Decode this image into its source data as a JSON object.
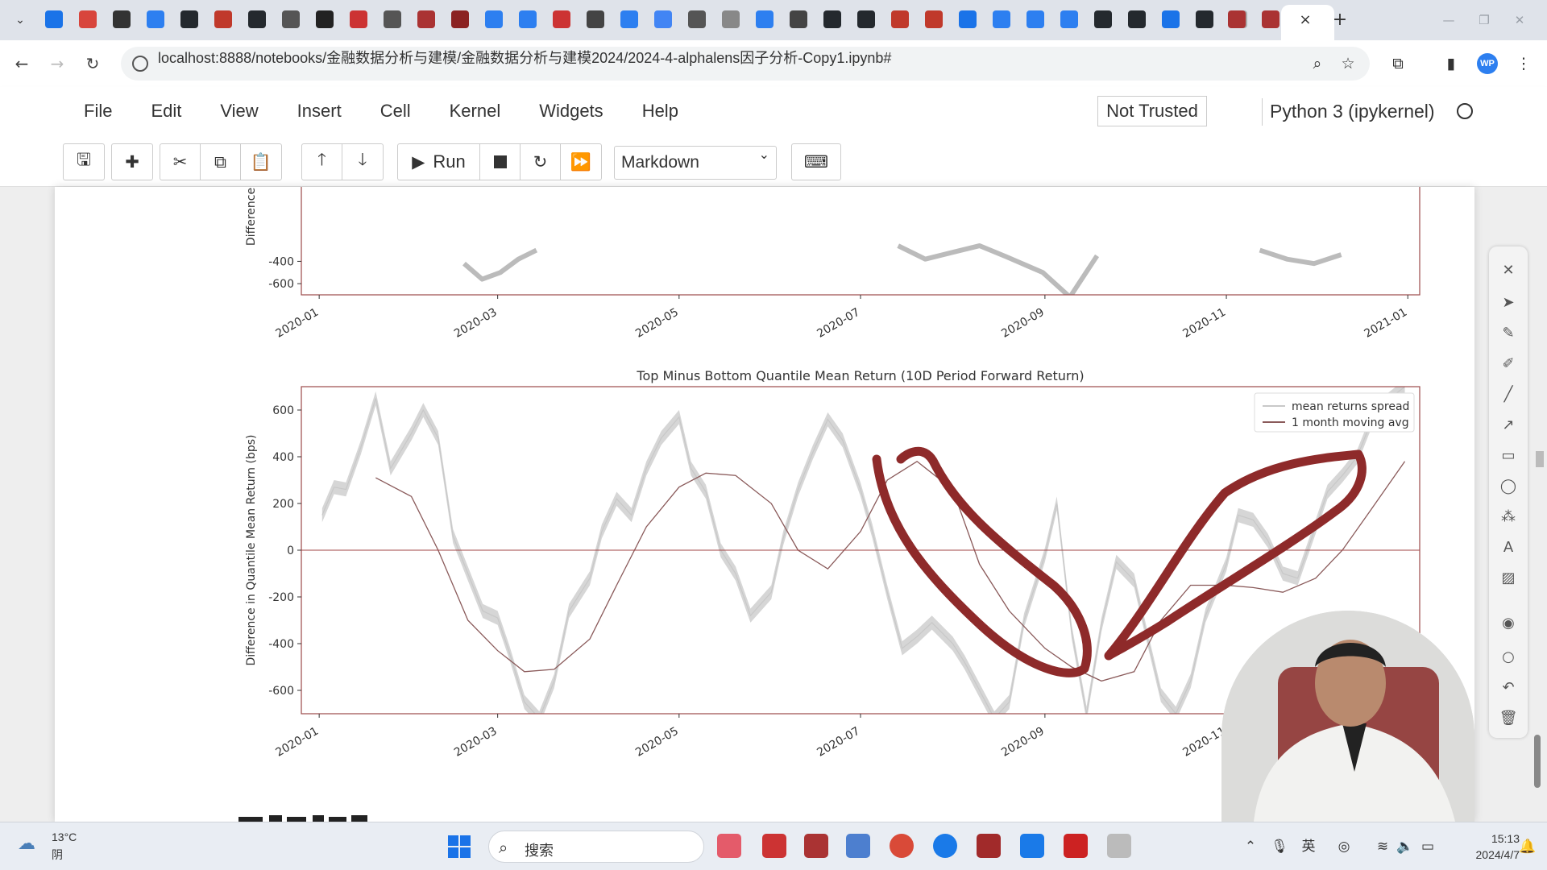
{
  "browser": {
    "tab_close": "×",
    "new_tab": "+",
    "tab_icons": [
      "bilibili",
      "weibo",
      "app",
      "zhihu",
      "github",
      "app-c",
      "github",
      "app",
      "ai",
      "app",
      "tds",
      "app",
      "app",
      "cloud",
      "cloud",
      "app",
      "book",
      "paw",
      "google",
      "app",
      "app",
      "twisted",
      "book",
      "github",
      "github",
      "app-c",
      "app-c",
      "app",
      "zhihu",
      "zhihu",
      "zhihu",
      "github",
      "github",
      "app",
      "github",
      "loading",
      "app",
      "app"
    ]
  },
  "address_bar": {
    "url": "localhost:8888/notebooks/金融数据分析与建模/金融数据分析与建模2024/2024-4-alphalens因子分析-Copy1.ipynb#"
  },
  "profile": {
    "initials": "WP"
  },
  "jupyter": {
    "menu": [
      "File",
      "Edit",
      "View",
      "Insert",
      "Cell",
      "Kernel",
      "Widgets",
      "Help"
    ],
    "trust_status": "Not Trusted",
    "kernel": "Python 3 (ipykernel)",
    "toolbar": {
      "run_label": "Run",
      "cell_type": "Markdown"
    }
  },
  "colors": {
    "spread_line": "#c8c8c8",
    "moving_avg": "#8a5a5a",
    "zero_line": "#a04545",
    "axes": "#9b4a4a",
    "annotation": "#8e2a2a",
    "accent": "#1a73e8"
  },
  "chart_data": [
    {
      "type": "line",
      "title": "",
      "ylabel": "Difference",
      "ylim": [
        -700,
        700
      ],
      "yticks": [
        "-400",
        "-600"
      ],
      "x_tick_labels": [
        "2020-01",
        "2020-03",
        "2020-05",
        "2020-07",
        "2020-09",
        "2020-11",
        "2021-01"
      ],
      "note": "partially visible (cropped at top)"
    },
    {
      "type": "line",
      "title": "Top Minus Bottom Quantile Mean Return (10D Period Forward Return)",
      "xlabel": "",
      "ylabel": "Difference in Quantile Mean Return (bps)",
      "ylim": [
        -700,
        700
      ],
      "yticks": [
        "600",
        "400",
        "200",
        "0",
        "-200",
        "-400",
        "-600"
      ],
      "x_tick_labels": [
        "2020-01",
        "2020-03",
        "2020-05",
        "2020-07",
        "2020-09",
        "2020-11",
        "2021-01"
      ],
      "legend": [
        "mean returns spread",
        "1 month moving avg"
      ],
      "legend_position": "top-right",
      "series": [
        {
          "name": "mean returns spread",
          "x": [
            "2020-01-02",
            "2020-01-06",
            "2020-01-10",
            "2020-01-15",
            "2020-01-20",
            "2020-01-25",
            "2020-02-01",
            "2020-02-05",
            "2020-02-10",
            "2020-02-15",
            "2020-02-20",
            "2020-02-25",
            "2020-03-01",
            "2020-03-05",
            "2020-03-10",
            "2020-03-15",
            "2020-03-20",
            "2020-03-25",
            "2020-04-01",
            "2020-04-05",
            "2020-04-10",
            "2020-04-15",
            "2020-04-20",
            "2020-04-25",
            "2020-05-01",
            "2020-05-05",
            "2020-05-10",
            "2020-05-15",
            "2020-05-20",
            "2020-05-25",
            "2020-06-01",
            "2020-06-05",
            "2020-06-10",
            "2020-06-15",
            "2020-06-20",
            "2020-06-25",
            "2020-07-01",
            "2020-07-05",
            "2020-07-10",
            "2020-07-15",
            "2020-07-20",
            "2020-07-25",
            "2020-08-01",
            "2020-08-05",
            "2020-08-10",
            "2020-08-15",
            "2020-08-20",
            "2020-08-25",
            "2020-09-01",
            "2020-09-05",
            "2020-09-10",
            "2020-09-15",
            "2020-09-20",
            "2020-09-25",
            "2020-10-01",
            "2020-10-05",
            "2020-10-10",
            "2020-10-15",
            "2020-10-20",
            "2020-10-25",
            "2020-11-01",
            "2020-11-05",
            "2020-11-10",
            "2020-11-15",
            "2020-11-20",
            "2020-11-25",
            "2020-12-01",
            "2020-12-05",
            "2020-12-10",
            "2020-12-15",
            "2020-12-20",
            "2020-12-25",
            "2020-12-31"
          ],
          "values": [
            150,
            270,
            260,
            440,
            650,
            350,
            500,
            600,
            480,
            60,
            -100,
            -260,
            -290,
            -440,
            -650,
            -720,
            -560,
            -260,
            -120,
            80,
            220,
            150,
            350,
            480,
            570,
            350,
            250,
            0,
            -100,
            -280,
            -180,
            50,
            260,
            420,
            560,
            470,
            260,
            80,
            -180,
            -420,
            -370,
            -310,
            -400,
            -480,
            -600,
            -720,
            -650,
            -300,
            -20,
            200,
            -350,
            -700,
            -320,
            -50,
            -130,
            -350,
            -620,
            -700,
            -560,
            -280,
            -60,
            150,
            130,
            40,
            -100,
            -120,
            100,
            250,
            320,
            400,
            560,
            640,
            700
          ]
        },
        {
          "name": "1 month moving avg",
          "x": [
            "2020-01-20",
            "2020-02-01",
            "2020-02-10",
            "2020-02-20",
            "2020-03-01",
            "2020-03-10",
            "2020-03-20",
            "2020-04-01",
            "2020-04-10",
            "2020-04-20",
            "2020-05-01",
            "2020-05-10",
            "2020-05-20",
            "2020-06-01",
            "2020-06-10",
            "2020-06-20",
            "2020-07-01",
            "2020-07-10",
            "2020-07-20",
            "2020-08-01",
            "2020-08-10",
            "2020-08-20",
            "2020-09-01",
            "2020-09-10",
            "2020-09-20",
            "2020-10-01",
            "2020-10-10",
            "2020-10-20",
            "2020-11-01",
            "2020-11-10",
            "2020-11-20",
            "2020-12-01",
            "2020-12-10",
            "2020-12-20",
            "2020-12-31"
          ],
          "values": [
            310,
            230,
            0,
            -300,
            -430,
            -520,
            -510,
            -380,
            -150,
            100,
            270,
            330,
            320,
            200,
            0,
            -80,
            80,
            300,
            380,
            260,
            -60,
            -260,
            -420,
            -500,
            -560,
            -520,
            -300,
            -150,
            -150,
            -160,
            -180,
            -120,
            0,
            180,
            380
          ]
        }
      ]
    }
  ],
  "webcam": {
    "label": "presenter webcam"
  },
  "taskbar": {
    "weather_temp": "13°C",
    "weather_cond": "阴",
    "search_label": "搜索",
    "time": "15:13",
    "date": "2024/4/7"
  }
}
